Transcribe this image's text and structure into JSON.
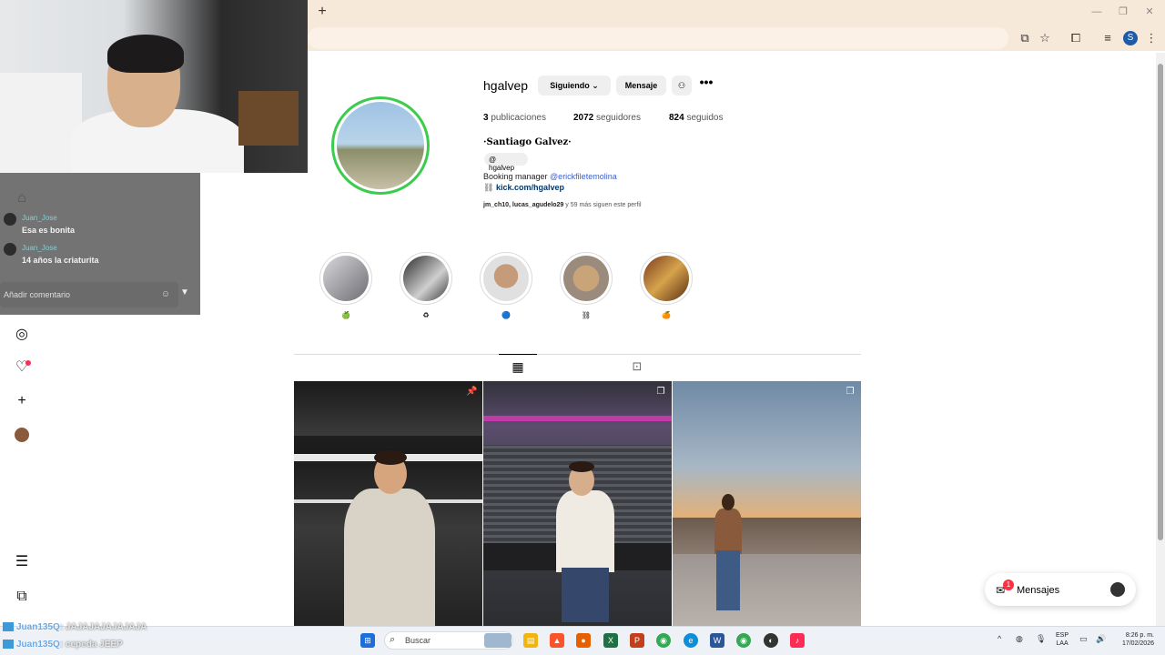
{
  "browser": {
    "new_tab_symbol": "+",
    "window_controls": [
      "—",
      "❐",
      "✕"
    ],
    "profile_letter": "S"
  },
  "chat": {
    "messages": [
      {
        "user": "Juan_Jose",
        "text": "Esa es bonita"
      },
      {
        "user": "Juan_Jose",
        "text": "14 años la criaturita"
      }
    ],
    "input_placeholder": "Añadir comentario"
  },
  "profile": {
    "username": "hgalvep",
    "following_button": "Siguiendo",
    "message_button": "Mensaje",
    "more_symbol": "•••",
    "stats": {
      "posts_count": "3",
      "posts_label": "publicaciones",
      "followers_count": "2072",
      "followers_label": "seguidores",
      "following_count": "824",
      "following_label": "seguidos"
    },
    "full_name": "·Santiago Galvez·",
    "threads_handle": "hgalvep",
    "bio_prefix": "Booking manager ",
    "bio_mention": "@erickfiletemolina",
    "link": "kick.com/hgalvep",
    "followed_by_names": "jm_ch10, lucas_agudelo29",
    "followed_by_suffix": " y 59 más siguen este perfil"
  },
  "highlights": [
    {
      "label": "🍏",
      "color": "#b8b8c0"
    },
    {
      "label": "♻",
      "color": "#555555"
    },
    {
      "label": "🔵",
      "color": "#c9a888"
    },
    {
      "label": "⛓",
      "color": "#c8b090"
    },
    {
      "label": "🍊",
      "color": "#9a5a2a"
    }
  ],
  "messages_pill": {
    "label": "Mensajes",
    "badge": "1"
  },
  "taskbar": {
    "search_placeholder": "Buscar",
    "lang_line1": "ESP",
    "lang_line2": "LAA",
    "time": "8:26 p. m.",
    "date": "17/02/2026"
  },
  "ticker": [
    {
      "user": "Juan135Q",
      "text": ": JAJAJAJAJAJAJA"
    },
    {
      "user": "Juan135Q",
      "text": ": cepeda JEEP"
    }
  ],
  "colors": {
    "accent_ring": "#3ccc4d",
    "link_blue": "#3d5fc7",
    "notification_red": "#ff3040",
    "chrome_tab_bg": "#f7e9da"
  }
}
